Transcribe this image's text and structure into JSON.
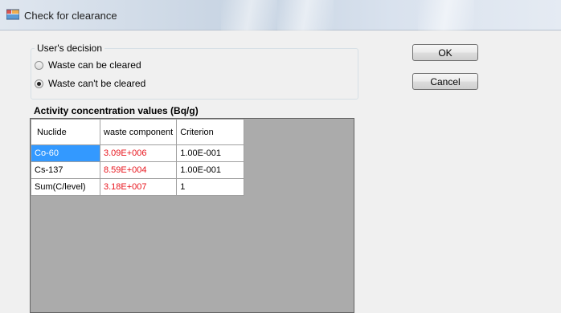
{
  "window": {
    "title": "Check for clearance"
  },
  "decision": {
    "legend": "User's decision",
    "options": [
      {
        "label": "Waste can be cleared",
        "checked": false
      },
      {
        "label": "Waste can't be cleared",
        "checked": true
      }
    ]
  },
  "buttons": {
    "ok": "OK",
    "cancel": "Cancel"
  },
  "grid": {
    "title": "Activity concentration values (Bq/g)",
    "columns": [
      "Nuclide",
      "waste component",
      "Criterion"
    ],
    "rows": [
      [
        "Co-60",
        "3.09E+006",
        "1.00E-001"
      ],
      [
        "Cs-137",
        "8.59E+004",
        "1.00E-001"
      ],
      [
        "Sum(C/level)",
        "3.18E+007",
        "1"
      ]
    ],
    "selected_row": 0
  },
  "colors": {
    "selection": "#3399ff",
    "exceeds_value": "#e8141c",
    "grid_background": "#ababab"
  }
}
